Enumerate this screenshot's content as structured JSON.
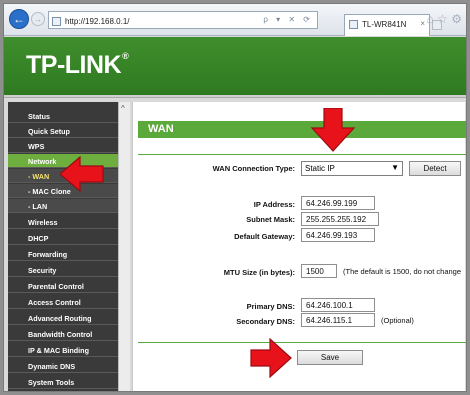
{
  "browser": {
    "address": "http://192.168.0.1/",
    "tab_title": "TL-WR841N",
    "tab_close": "×",
    "back": "←",
    "forward": "→",
    "address_tools": "ρ ▾ ✕ ⟳",
    "window_icons": "⌂ ☆ ⚙"
  },
  "header": {
    "logo": "TP-LINK",
    "logo_mark": "®"
  },
  "sidebar": {
    "scroll_up": "^",
    "items": [
      {
        "label": "Status"
      },
      {
        "label": "Quick Setup"
      },
      {
        "label": "WPS"
      },
      {
        "label": "Network"
      },
      {
        "label": "- WAN"
      },
      {
        "label": "- MAC Clone"
      },
      {
        "label": "- LAN"
      },
      {
        "label": "Wireless"
      },
      {
        "label": "DHCP"
      },
      {
        "label": "Forwarding"
      },
      {
        "label": "Security"
      },
      {
        "label": "Parental Control"
      },
      {
        "label": "Access Control"
      },
      {
        "label": "Advanced Routing"
      },
      {
        "label": "Bandwidth Control"
      },
      {
        "label": "IP & MAC Binding"
      },
      {
        "label": "Dynamic DNS"
      },
      {
        "label": "System Tools"
      }
    ]
  },
  "wan": {
    "title": "WAN",
    "connection_type_label": "WAN Connection Type:",
    "connection_type_value": "Static IP",
    "select_arrow": "▼",
    "detect_label": "Detect",
    "ip_label": "IP Address:",
    "ip_value": "64.246.99.199",
    "mask_label": "Subnet Mask:",
    "mask_value": "255.255.255.192",
    "gateway_label": "Default Gateway:",
    "gateway_value": "64.246.99.193",
    "mtu_label": "MTU Size (in bytes):",
    "mtu_value": "1500",
    "mtu_hint": "(The default is 1500, do not change",
    "primary_dns_label": "Primary DNS:",
    "primary_dns_value": "64.246.100.1",
    "secondary_dns_label": "Secondary DNS:",
    "secondary_dns_value": "64.246.115.1",
    "optional_hint": "(Optional)",
    "save_label": "Save"
  },
  "colors": {
    "brand_green": "#3f8e2c",
    "active_green": "#6dae3e",
    "arrow_red": "#e8121b"
  }
}
